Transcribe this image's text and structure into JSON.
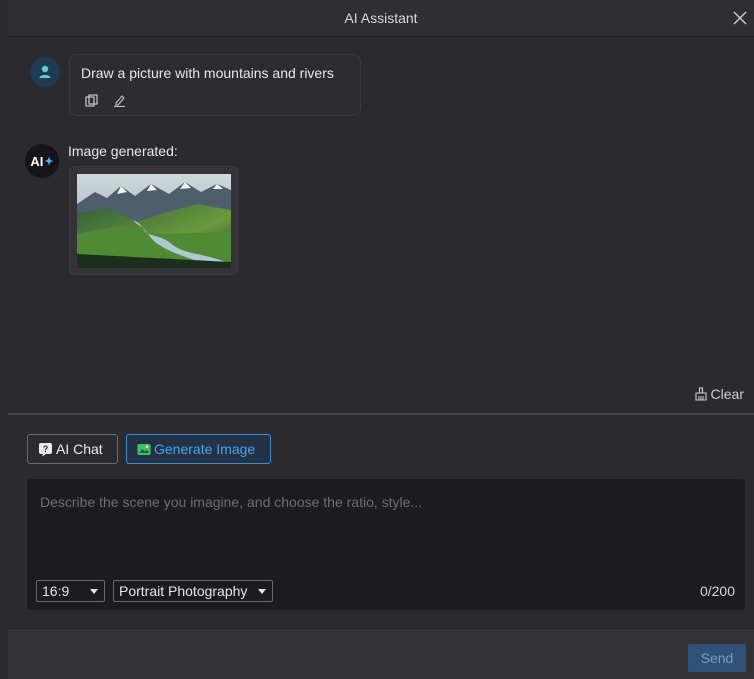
{
  "window": {
    "title": "AI Assistant"
  },
  "conversation": {
    "user_message": "Draw a picture with mountains and rivers",
    "ai_avatar_text": "AI",
    "ai_label": "Image generated:",
    "image_alt": "Generated image of mountains and a river"
  },
  "toolbar": {
    "clear_label": "Clear"
  },
  "modes": {
    "chat_label": "AI Chat",
    "generate_label": "Generate Image",
    "active": "Generate Image"
  },
  "input": {
    "placeholder": "Describe the scene you imagine, and choose the ratio, style...",
    "value": "",
    "ratio_selected": "16:9",
    "style_selected": "Portrait Photography",
    "counter": "0/200"
  },
  "footer": {
    "send_label": "Send"
  },
  "colors": {
    "accent": "#3f8fd0",
    "send_bg": "#2f5078",
    "background": "#2b2b2f"
  }
}
